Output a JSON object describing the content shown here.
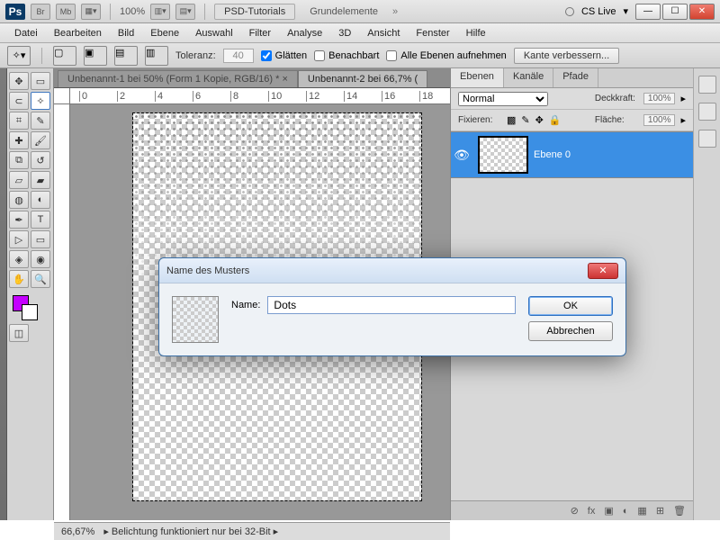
{
  "app": {
    "logo": "Ps",
    "br": "Br",
    "mb": "Mb",
    "zoom": "100%",
    "workspace_active": "PSD-Tutorials",
    "workspace_other": "Grundelemente",
    "cslive": "CS Live"
  },
  "menu": [
    "Datei",
    "Bearbeiten",
    "Bild",
    "Ebene",
    "Auswahl",
    "Filter",
    "Analyse",
    "3D",
    "Ansicht",
    "Fenster",
    "Hilfe"
  ],
  "options": {
    "tolerance_label": "Toleranz:",
    "tolerance_value": "40",
    "antialias": "Glätten",
    "contiguous": "Benachbart",
    "all_layers": "Alle Ebenen aufnehmen",
    "refine_edge": "Kante verbessern..."
  },
  "tabs": {
    "t1": "Unbenannt-1 bei 50% (Form 1 Kopie, RGB/16) *",
    "t2": "Unbenannt-2 bei 66,7% ("
  },
  "ruler_marks": [
    "0",
    "2",
    "4",
    "6",
    "8",
    "10",
    "12",
    "14",
    "16",
    "18"
  ],
  "panels": {
    "tabs": [
      "Ebenen",
      "Kanäle",
      "Pfade"
    ],
    "blend_mode": "Normal",
    "opacity_label": "Deckkraft:",
    "opacity_value": "100%",
    "lock_label": "Fixieren:",
    "fill_label": "Fläche:",
    "fill_value": "100%",
    "layer_name": "Ebene 0",
    "footer_icons": [
      "⊘",
      "fx",
      "▣",
      "◐",
      "▦",
      "⊞",
      "🗑"
    ]
  },
  "status": {
    "zoom": "66,67%",
    "info": "Belichtung funktioniert nur bei 32-Bit"
  },
  "dialog": {
    "title": "Name des Musters",
    "name_label": "Name:",
    "name_value": "Dots",
    "ok": "OK",
    "cancel": "Abbrechen"
  },
  "window_controls": {
    "min": "—",
    "max": "☐",
    "close": "✕"
  }
}
